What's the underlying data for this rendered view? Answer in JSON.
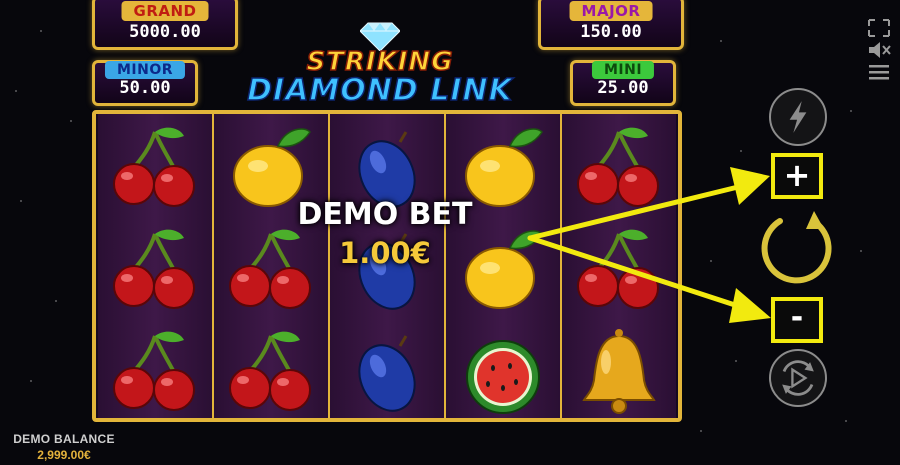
{
  "jackpots": {
    "grand": {
      "label": "GRAND",
      "value": "5000.00"
    },
    "major": {
      "label": "MAJOR",
      "value": "150.00"
    },
    "minor": {
      "label": "MINOR",
      "value": "50.00"
    },
    "mini": {
      "label": "MINI",
      "value": "25.00"
    }
  },
  "logo": {
    "line1": "STRIKING",
    "line2": "DIAMOND LINK"
  },
  "overlay": {
    "title": "DEMO BET",
    "value": "1.00€"
  },
  "reels": [
    [
      "cherry",
      "cherry",
      "cherry"
    ],
    [
      "lemon",
      "cherry",
      "cherry"
    ],
    [
      "plum",
      "plum",
      "plum"
    ],
    [
      "lemon",
      "lemon",
      "watermelon"
    ],
    [
      "cherry",
      "cherry",
      "bell"
    ]
  ],
  "controls": {
    "turbo_icon": "lightning-icon",
    "plus_label": "+",
    "minus_label": "-",
    "spin_icon": "spin-icon",
    "autoplay_icon": "autoplay-icon"
  },
  "top_icons": [
    "fullscreen-icon",
    "sound-muted-icon",
    "menu-icon"
  ],
  "balance": {
    "label": "DEMO BALANCE",
    "value": "2,999.00€"
  },
  "colors": {
    "highlight": "#f2ea0f",
    "gold": "#e2b53a",
    "bet_value": "#f5c93a"
  }
}
